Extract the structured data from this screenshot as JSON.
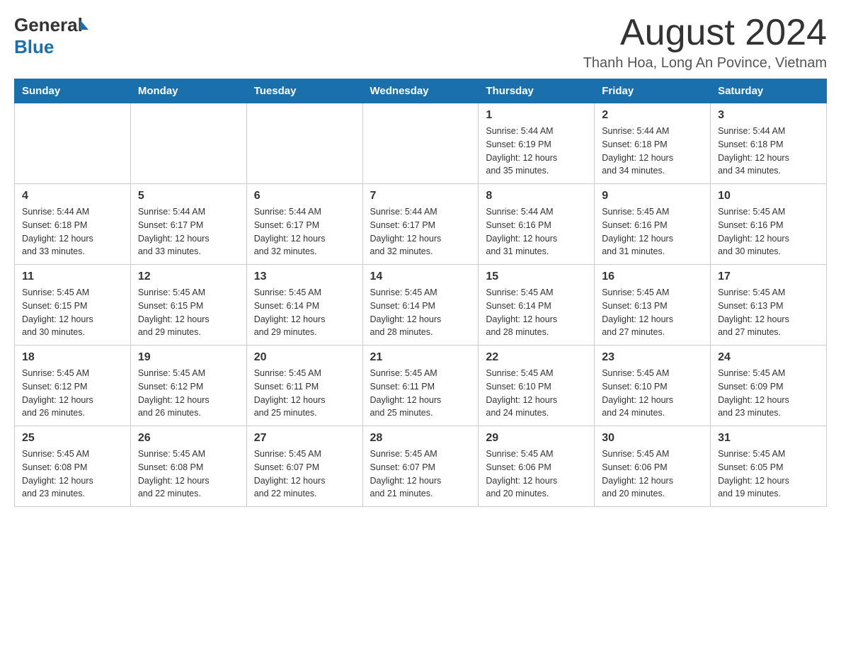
{
  "header": {
    "logo_general": "General",
    "logo_blue": "Blue",
    "month": "August 2024",
    "location": "Thanh Hoa, Long An Povince, Vietnam"
  },
  "weekdays": [
    "Sunday",
    "Monday",
    "Tuesday",
    "Wednesday",
    "Thursday",
    "Friday",
    "Saturday"
  ],
  "weeks": [
    [
      {
        "day": "",
        "info": ""
      },
      {
        "day": "",
        "info": ""
      },
      {
        "day": "",
        "info": ""
      },
      {
        "day": "",
        "info": ""
      },
      {
        "day": "1",
        "info": "Sunrise: 5:44 AM\nSunset: 6:19 PM\nDaylight: 12 hours\nand 35 minutes."
      },
      {
        "day": "2",
        "info": "Sunrise: 5:44 AM\nSunset: 6:18 PM\nDaylight: 12 hours\nand 34 minutes."
      },
      {
        "day": "3",
        "info": "Sunrise: 5:44 AM\nSunset: 6:18 PM\nDaylight: 12 hours\nand 34 minutes."
      }
    ],
    [
      {
        "day": "4",
        "info": "Sunrise: 5:44 AM\nSunset: 6:18 PM\nDaylight: 12 hours\nand 33 minutes."
      },
      {
        "day": "5",
        "info": "Sunrise: 5:44 AM\nSunset: 6:17 PM\nDaylight: 12 hours\nand 33 minutes."
      },
      {
        "day": "6",
        "info": "Sunrise: 5:44 AM\nSunset: 6:17 PM\nDaylight: 12 hours\nand 32 minutes."
      },
      {
        "day": "7",
        "info": "Sunrise: 5:44 AM\nSunset: 6:17 PM\nDaylight: 12 hours\nand 32 minutes."
      },
      {
        "day": "8",
        "info": "Sunrise: 5:44 AM\nSunset: 6:16 PM\nDaylight: 12 hours\nand 31 minutes."
      },
      {
        "day": "9",
        "info": "Sunrise: 5:45 AM\nSunset: 6:16 PM\nDaylight: 12 hours\nand 31 minutes."
      },
      {
        "day": "10",
        "info": "Sunrise: 5:45 AM\nSunset: 6:16 PM\nDaylight: 12 hours\nand 30 minutes."
      }
    ],
    [
      {
        "day": "11",
        "info": "Sunrise: 5:45 AM\nSunset: 6:15 PM\nDaylight: 12 hours\nand 30 minutes."
      },
      {
        "day": "12",
        "info": "Sunrise: 5:45 AM\nSunset: 6:15 PM\nDaylight: 12 hours\nand 29 minutes."
      },
      {
        "day": "13",
        "info": "Sunrise: 5:45 AM\nSunset: 6:14 PM\nDaylight: 12 hours\nand 29 minutes."
      },
      {
        "day": "14",
        "info": "Sunrise: 5:45 AM\nSunset: 6:14 PM\nDaylight: 12 hours\nand 28 minutes."
      },
      {
        "day": "15",
        "info": "Sunrise: 5:45 AM\nSunset: 6:14 PM\nDaylight: 12 hours\nand 28 minutes."
      },
      {
        "day": "16",
        "info": "Sunrise: 5:45 AM\nSunset: 6:13 PM\nDaylight: 12 hours\nand 27 minutes."
      },
      {
        "day": "17",
        "info": "Sunrise: 5:45 AM\nSunset: 6:13 PM\nDaylight: 12 hours\nand 27 minutes."
      }
    ],
    [
      {
        "day": "18",
        "info": "Sunrise: 5:45 AM\nSunset: 6:12 PM\nDaylight: 12 hours\nand 26 minutes."
      },
      {
        "day": "19",
        "info": "Sunrise: 5:45 AM\nSunset: 6:12 PM\nDaylight: 12 hours\nand 26 minutes."
      },
      {
        "day": "20",
        "info": "Sunrise: 5:45 AM\nSunset: 6:11 PM\nDaylight: 12 hours\nand 25 minutes."
      },
      {
        "day": "21",
        "info": "Sunrise: 5:45 AM\nSunset: 6:11 PM\nDaylight: 12 hours\nand 25 minutes."
      },
      {
        "day": "22",
        "info": "Sunrise: 5:45 AM\nSunset: 6:10 PM\nDaylight: 12 hours\nand 24 minutes."
      },
      {
        "day": "23",
        "info": "Sunrise: 5:45 AM\nSunset: 6:10 PM\nDaylight: 12 hours\nand 24 minutes."
      },
      {
        "day": "24",
        "info": "Sunrise: 5:45 AM\nSunset: 6:09 PM\nDaylight: 12 hours\nand 23 minutes."
      }
    ],
    [
      {
        "day": "25",
        "info": "Sunrise: 5:45 AM\nSunset: 6:08 PM\nDaylight: 12 hours\nand 23 minutes."
      },
      {
        "day": "26",
        "info": "Sunrise: 5:45 AM\nSunset: 6:08 PM\nDaylight: 12 hours\nand 22 minutes."
      },
      {
        "day": "27",
        "info": "Sunrise: 5:45 AM\nSunset: 6:07 PM\nDaylight: 12 hours\nand 22 minutes."
      },
      {
        "day": "28",
        "info": "Sunrise: 5:45 AM\nSunset: 6:07 PM\nDaylight: 12 hours\nand 21 minutes."
      },
      {
        "day": "29",
        "info": "Sunrise: 5:45 AM\nSunset: 6:06 PM\nDaylight: 12 hours\nand 20 minutes."
      },
      {
        "day": "30",
        "info": "Sunrise: 5:45 AM\nSunset: 6:06 PM\nDaylight: 12 hours\nand 20 minutes."
      },
      {
        "day": "31",
        "info": "Sunrise: 5:45 AM\nSunset: 6:05 PM\nDaylight: 12 hours\nand 19 minutes."
      }
    ]
  ]
}
